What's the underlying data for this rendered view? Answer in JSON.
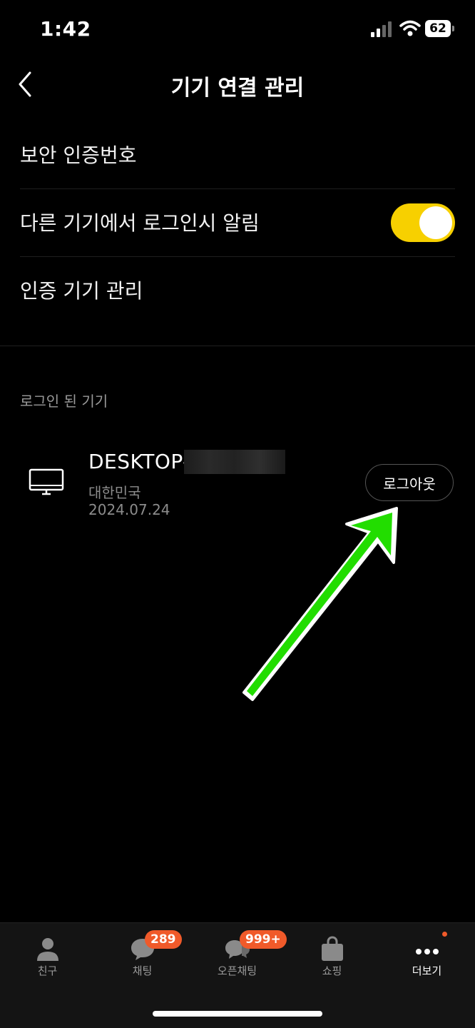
{
  "status_bar": {
    "time": "1:42",
    "battery": "62"
  },
  "header": {
    "title": "기기 연결 관리"
  },
  "settings": {
    "items": [
      {
        "label": "보안 인증번호"
      },
      {
        "label": "다른 기기에서 로그인시 알림",
        "toggle_on": true
      },
      {
        "label": "인증 기기 관리"
      }
    ]
  },
  "logged_in": {
    "section_title": "로그인 된 기기",
    "device": {
      "name": "DESKTOP-",
      "country": "대한민국",
      "date": "2024.07.24",
      "logout_label": "로그아웃"
    }
  },
  "tab_bar": {
    "tabs": [
      {
        "label": "친구",
        "icon": "person-icon"
      },
      {
        "label": "채팅",
        "icon": "chat-bubble-icon",
        "badge": "289"
      },
      {
        "label": "오픈채팅",
        "icon": "open-chat-icon",
        "badge": "999+"
      },
      {
        "label": "쇼핑",
        "icon": "shopping-bag-icon"
      },
      {
        "label": "더보기",
        "icon": "more-dots-icon",
        "active": true
      }
    ]
  },
  "colors": {
    "toggle_on": "#f7d000",
    "badge": "#f05a2a",
    "annotation_arrow": "#22dd00"
  }
}
